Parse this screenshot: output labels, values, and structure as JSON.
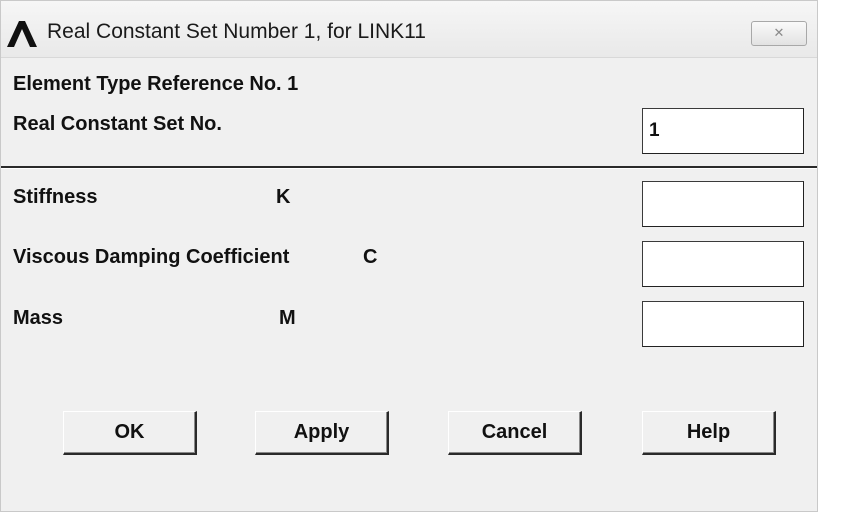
{
  "window": {
    "title": "Real Constant Set Number 1, for LINK11",
    "logo_icon": "ansys-logo-icon",
    "close_icon": "close-icon"
  },
  "header": {
    "element_type_ref": "Element Type Reference No. 1",
    "set_label": "Real Constant Set No.",
    "set_value": "1"
  },
  "fields": [
    {
      "label": "Stiffness",
      "symbol": "K",
      "value": ""
    },
    {
      "label": "Viscous Damping Coefficient",
      "symbol": "C",
      "value": ""
    },
    {
      "label": "Mass",
      "symbol": "M",
      "value": ""
    }
  ],
  "buttons": {
    "ok": "OK",
    "apply": "Apply",
    "cancel": "Cancel",
    "help": "Help"
  }
}
